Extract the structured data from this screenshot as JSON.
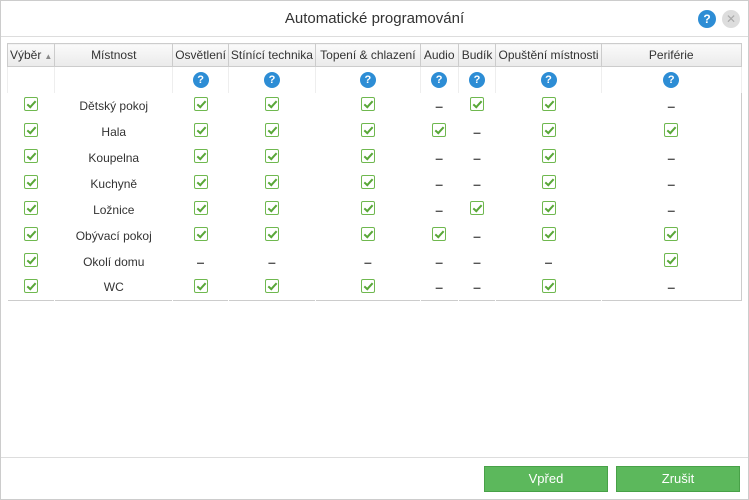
{
  "title": "Automatické programování",
  "columns": {
    "vyber": "Výběr",
    "mistnost": "Místnost",
    "osvetleni": "Osvětlení",
    "stinici": "Stínící technika",
    "topeni": "Topení & chlazení",
    "audio": "Audio",
    "budik": "Budík",
    "opusteni": "Opuštění místnosti",
    "periferie": "Periférie"
  },
  "buttons": {
    "vpred": "Vpřed",
    "zrusit": "Zrušit"
  },
  "rows": [
    {
      "name": "Dětský pokoj",
      "vyber": true,
      "osvetleni": "c",
      "stinici": "c",
      "topeni": "c",
      "audio": "d",
      "budik": "c",
      "opusteni": "c",
      "periferie": "d"
    },
    {
      "name": "Hala",
      "vyber": true,
      "osvetleni": "c",
      "stinici": "c",
      "topeni": "c",
      "audio": "c",
      "budik": "d",
      "opusteni": "c",
      "periferie": "c"
    },
    {
      "name": "Koupelna",
      "vyber": true,
      "osvetleni": "c",
      "stinici": "c",
      "topeni": "c",
      "audio": "d",
      "budik": "d",
      "opusteni": "c",
      "periferie": "d"
    },
    {
      "name": "Kuchyně",
      "vyber": true,
      "osvetleni": "c",
      "stinici": "c",
      "topeni": "c",
      "audio": "d",
      "budik": "d",
      "opusteni": "c",
      "periferie": "d"
    },
    {
      "name": "Ložnice",
      "vyber": true,
      "osvetleni": "c",
      "stinici": "c",
      "topeni": "c",
      "audio": "d",
      "budik": "c",
      "opusteni": "c",
      "periferie": "d"
    },
    {
      "name": "Obývací pokoj",
      "vyber": true,
      "osvetleni": "c",
      "stinici": "c",
      "topeni": "c",
      "audio": "c",
      "budik": "d",
      "opusteni": "c",
      "periferie": "c"
    },
    {
      "name": "Okolí domu",
      "vyber": true,
      "osvetleni": "d",
      "stinici": "d",
      "topeni": "d",
      "audio": "d",
      "budik": "d",
      "opusteni": "d",
      "periferie": "c"
    },
    {
      "name": "WC",
      "vyber": true,
      "osvetleni": "c",
      "stinici": "c",
      "topeni": "c",
      "audio": "d",
      "budik": "d",
      "opusteni": "c",
      "periferie": "d"
    }
  ],
  "helpCols": [
    "osvetleni",
    "stinici",
    "topeni",
    "audio",
    "budik",
    "opusteni",
    "periferie"
  ]
}
